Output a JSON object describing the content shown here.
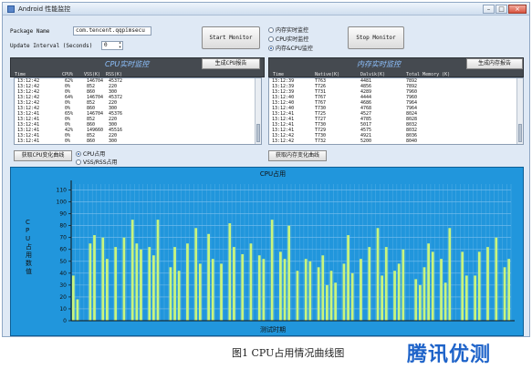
{
  "window": {
    "title": "Android 性能监控"
  },
  "form": {
    "package_label": "Package Name",
    "package_value": "com.tencent.qqpimsecu",
    "interval_label": "Update Interval (Seconds)",
    "interval_value": "0",
    "start_label": "Start  Monitor",
    "stop_label": "Stop Monitor",
    "modes": [
      {
        "label": "内存实时监控",
        "selected": false
      },
      {
        "label": "CPU实时监控",
        "selected": false
      },
      {
        "label": "内存&CPU监控",
        "selected": true
      }
    ]
  },
  "cpu_panel": {
    "title": "CPU实时监控",
    "report_button": "生成CPU报告",
    "curve_button": "获取CPU变化曲线",
    "headers": [
      "Time",
      "CPU%",
      "VSS(K)",
      "RSS(K)"
    ],
    "rows": [
      [
        "13:12:42",
        "62%",
        "146704",
        "45372"
      ],
      [
        "13:12:42",
        "0%",
        "852",
        "220"
      ],
      [
        "13:12:42",
        "0%",
        "860",
        "300"
      ],
      [
        "13:12:42",
        "64%",
        "146704",
        "45372"
      ],
      [
        "13:12:42",
        "0%",
        "852",
        "220"
      ],
      [
        "13:12:42",
        "0%",
        "860",
        "300"
      ],
      [
        "13:12:41",
        "65%",
        "146704",
        "45376"
      ],
      [
        "13:12:41",
        "0%",
        "852",
        "220"
      ],
      [
        "13:12:41",
        "0%",
        "860",
        "300"
      ],
      [
        "13:12:41",
        "42%",
        "149660",
        "45516"
      ],
      [
        "13:12:41",
        "0%",
        "852",
        "220"
      ],
      [
        "13:12:41",
        "0%",
        "860",
        "300"
      ]
    ],
    "curve_options": [
      {
        "label": "CPU占用",
        "selected": true
      },
      {
        "label": "VSS/RSS占用",
        "selected": false
      }
    ]
  },
  "mem_panel": {
    "title": "内存实时监控",
    "report_button": "生成内存报告",
    "curve_button": "获取内存变化曲线",
    "headers": [
      "Time",
      "Native(K)",
      "Dalvik(K)",
      "Total Memory (K)"
    ],
    "rows": [
      [
        "13:12:39",
        "T763",
        "4481",
        "7892"
      ],
      [
        "13:12:39",
        "T726",
        "4856",
        "7892"
      ],
      [
        "13:12:39",
        "T731",
        "4289",
        "7960"
      ],
      [
        "13:12:40",
        "T767",
        "4444",
        "7960"
      ],
      [
        "13:12:40",
        "T767",
        "4686",
        "7964"
      ],
      [
        "13:12:40",
        "T730",
        "4768",
        "7964"
      ],
      [
        "13:12:41",
        "T725",
        "4527",
        "8024"
      ],
      [
        "13:12:41",
        "T727",
        "4785",
        "8028"
      ],
      [
        "13:12:41",
        "T730",
        "5017",
        "8032"
      ],
      [
        "13:12:41",
        "T729",
        "4575",
        "8032"
      ],
      [
        "13:12:42",
        "T730",
        "4921",
        "8036"
      ],
      [
        "13:12:42",
        "T732",
        "5200",
        "8040"
      ]
    ]
  },
  "chart_data": {
    "type": "bar",
    "title": "CPU占用",
    "xlabel": "测试时期",
    "ylabel": "CPU占用数值",
    "ylim": [
      0,
      115
    ],
    "yticks": [
      0,
      10,
      20,
      30,
      40,
      50,
      60,
      70,
      80,
      90,
      100,
      110
    ],
    "values": [
      38,
      18,
      0,
      0,
      65,
      72,
      0,
      70,
      52,
      0,
      62,
      0,
      70,
      0,
      85,
      65,
      60,
      0,
      62,
      55,
      85,
      0,
      0,
      45,
      62,
      42,
      0,
      65,
      0,
      78,
      48,
      0,
      73,
      52,
      0,
      48,
      0,
      82,
      62,
      0,
      56,
      0,
      65,
      0,
      55,
      52,
      0,
      85,
      0,
      58,
      52,
      80,
      0,
      42,
      0,
      52,
      50,
      0,
      45,
      55,
      30,
      42,
      32,
      0,
      48,
      72,
      40,
      0,
      52,
      0,
      62,
      0,
      78,
      38,
      62,
      0,
      42,
      48,
      60,
      0,
      0,
      35,
      30,
      45,
      65,
      58,
      0,
      52,
      32,
      78,
      0,
      0,
      58,
      38,
      0,
      38,
      58,
      0,
      62,
      0,
      70,
      0,
      45,
      52
    ],
    "colors": {
      "background": "#2196dc",
      "bar": "#c9f57e",
      "grid": "#7cc0ee",
      "axis": "#111111"
    }
  },
  "caption": "图1   CPU占用情况曲线图",
  "watermark": "腾讯优测"
}
